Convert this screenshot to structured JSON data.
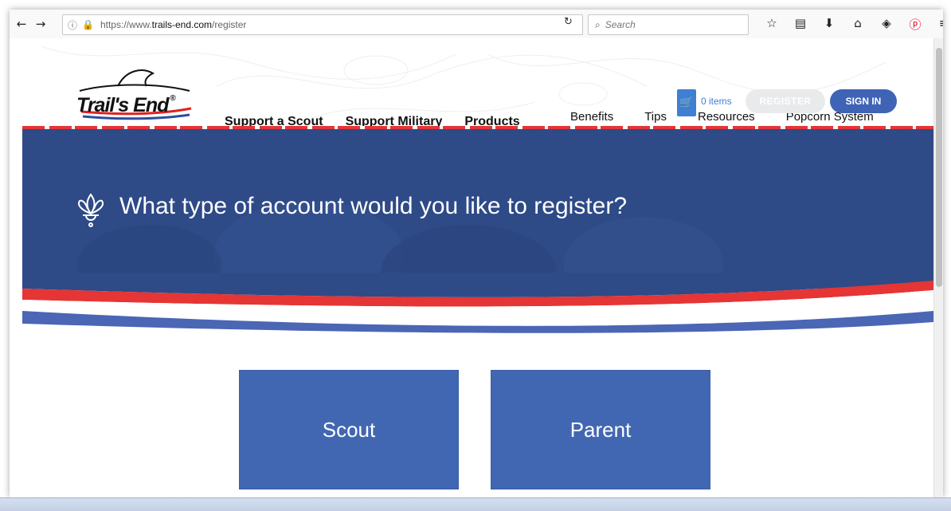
{
  "browser": {
    "url_prefix": "https://www.",
    "url_domain": "trails-end.com",
    "url_path": "/register",
    "search_placeholder": "Search",
    "icons": [
      "back-icon",
      "forward-icon",
      "info-icon",
      "lock-icon",
      "reload-icon",
      "search-icon",
      "star-icon",
      "reader-icon",
      "download-icon",
      "home-icon",
      "pocket-icon",
      "pinterest-icon",
      "menu-icon"
    ]
  },
  "header": {
    "logo_text": "Trail's End",
    "logo_reg": "®",
    "main_nav": [
      "Support a Scout",
      "Support Military",
      "Products"
    ],
    "sub_nav": [
      "Benefits",
      "Tips",
      "Resources",
      "Popcorn System"
    ],
    "cart_label": "0 items",
    "register_label": "REGISTER",
    "signin_label": "SIGN IN"
  },
  "hero": {
    "title": "What type of account would you like to register?"
  },
  "choices": {
    "scout_label": "Scout",
    "parent_label": "Parent"
  },
  "colors": {
    "brand_blue": "#2e4a87",
    "button_blue": "#4267b2",
    "accent_red": "#e53535",
    "link_blue": "#3f7fd4"
  }
}
